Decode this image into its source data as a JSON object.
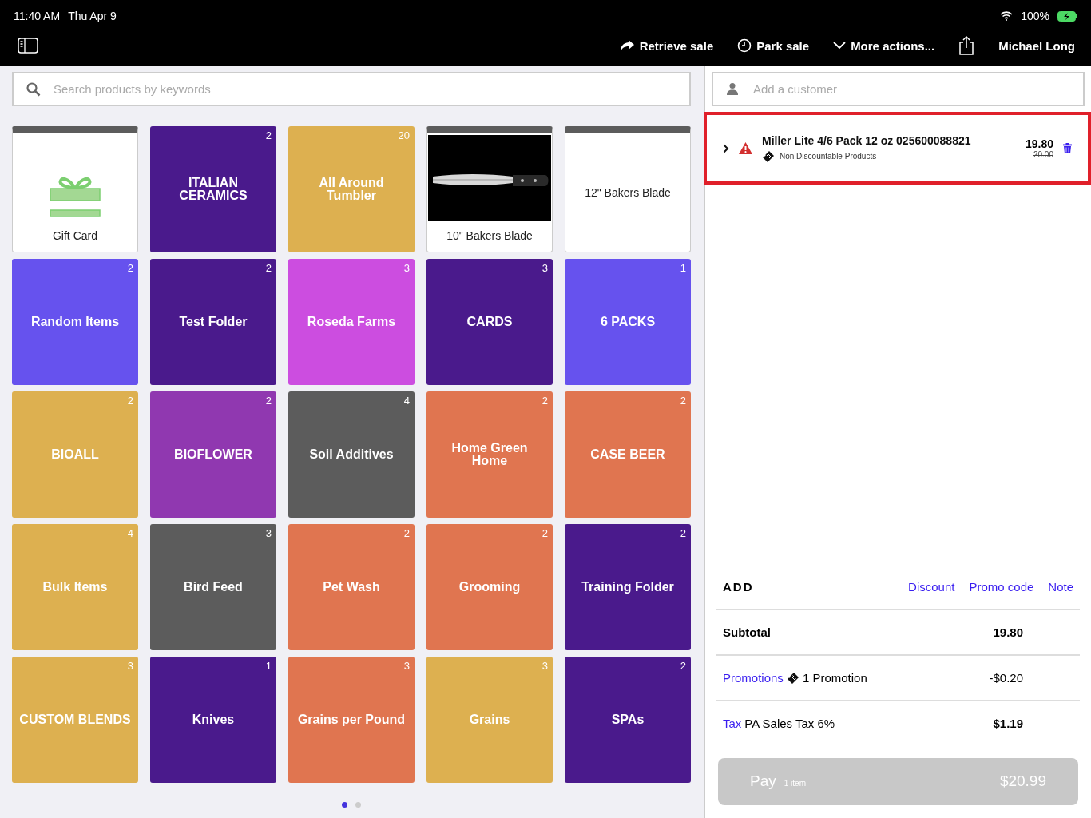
{
  "status_bar": {
    "time": "11:40 AM",
    "date": "Thu Apr 9",
    "battery": "100%"
  },
  "toolbar": {
    "actions": [
      {
        "label": "Retrieve sale",
        "kind": "retrieve"
      },
      {
        "label": "Park sale",
        "kind": "park"
      },
      {
        "label": "More actions...",
        "kind": "more"
      }
    ],
    "user": "Michael Long"
  },
  "search": {
    "placeholder": "Search products by keywords"
  },
  "tiles": [
    {
      "kind": "gift_card",
      "label": "Gift Card"
    },
    {
      "kind": "folder",
      "label": "ITALIAN CERAMICS",
      "count": "2",
      "color": "#4a1a8c"
    },
    {
      "kind": "folder",
      "label": "All Around Tumbler",
      "count": "20",
      "color": "#ddb050"
    },
    {
      "kind": "photo_product",
      "label": "10\" Bakers Blade"
    },
    {
      "kind": "product",
      "label": "12\" Bakers Blade"
    },
    {
      "kind": "folder",
      "label": "Random Items",
      "count": "2",
      "color": "#6652ee"
    },
    {
      "kind": "folder",
      "label": "Test Folder",
      "count": "2",
      "color": "#4a1a8c"
    },
    {
      "kind": "folder",
      "label": "Roseda Farms",
      "count": "3",
      "color": "#cc4de0"
    },
    {
      "kind": "folder",
      "label": "CARDS",
      "count": "3",
      "color": "#4a1a8c"
    },
    {
      "kind": "folder",
      "label": "6 PACKS",
      "count": "1",
      "color": "#6652ee"
    },
    {
      "kind": "folder",
      "label": "BIOALL",
      "count": "2",
      "color": "#ddb050"
    },
    {
      "kind": "folder",
      "label": "BIOFLOWER",
      "count": "2",
      "color": "#9038b0"
    },
    {
      "kind": "folder",
      "label": "Soil Additives",
      "count": "4",
      "color": "#5c5c5c"
    },
    {
      "kind": "folder",
      "label": "Home Green Home",
      "count": "2",
      "color": "#e07550"
    },
    {
      "kind": "folder",
      "label": "CASE BEER",
      "count": "2",
      "color": "#e07550"
    },
    {
      "kind": "folder",
      "label": "Bulk Items",
      "count": "4",
      "color": "#ddb050"
    },
    {
      "kind": "folder",
      "label": "Bird Feed",
      "count": "3",
      "color": "#5c5c5c"
    },
    {
      "kind": "folder",
      "label": "Pet Wash",
      "count": "2",
      "color": "#e07550"
    },
    {
      "kind": "folder",
      "label": "Grooming",
      "count": "2",
      "color": "#e07550"
    },
    {
      "kind": "folder",
      "label": "Training Folder",
      "count": "2",
      "color": "#4a1a8c"
    },
    {
      "kind": "folder",
      "label": "CUSTOM BLENDS",
      "count": "3",
      "color": "#ddb050"
    },
    {
      "kind": "folder",
      "label": "Knives",
      "count": "1",
      "color": "#4a1a8c"
    },
    {
      "kind": "folder",
      "label": "Grains per Pound",
      "count": "3",
      "color": "#e07550"
    },
    {
      "kind": "folder",
      "label": "Grains",
      "count": "3",
      "color": "#ddb050"
    },
    {
      "kind": "folder",
      "label": "SPAs",
      "count": "2",
      "color": "#4a1a8c"
    }
  ],
  "pages": [
    {
      "selected": true
    },
    {
      "selected": false
    }
  ],
  "customer": {
    "placeholder": "Add a customer"
  },
  "cart_items": [
    {
      "name": "Miller Lite 4/6 Pack 12 oz 025600088821",
      "note": "Non Discountable Products",
      "price": "19.80",
      "original_price": "20.00",
      "warning": true,
      "highlighted": true
    }
  ],
  "add": {
    "title": "ADD",
    "links": [
      "Discount",
      "Promo code",
      "Note"
    ]
  },
  "summary": [
    {
      "kind": "plain",
      "label": "Subtotal",
      "value": "19.80"
    },
    {
      "kind": "promo",
      "label": "Promotions",
      "detail": "1 Promotion",
      "value": "-$0.20"
    },
    {
      "kind": "link",
      "label": "Tax",
      "detail": "PA Sales Tax 6%",
      "value": "$1.19"
    }
  ],
  "pay": {
    "label": "Pay",
    "items": "1 item",
    "total": "$20.99",
    "disabled": true
  }
}
